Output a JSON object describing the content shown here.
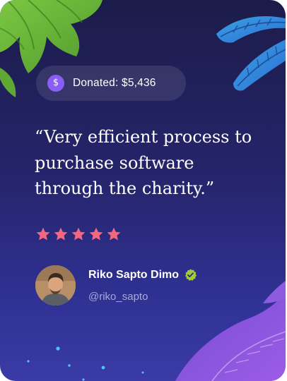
{
  "donation": {
    "icon": "dollar-icon",
    "text": "Donated: $5,436"
  },
  "testimonial": {
    "quote": "“Very efficient process to purchase software through the charity.”",
    "rating": 5,
    "star_color": "#f5677c"
  },
  "author": {
    "name": "Riko Sapto Dimo",
    "handle": "@riko_sapto",
    "verified_color": "#a3c93a"
  },
  "colors": {
    "background_top": "#1c1c4a",
    "background_bottom": "#3a3ba6",
    "accent": "#8b5cf6"
  }
}
